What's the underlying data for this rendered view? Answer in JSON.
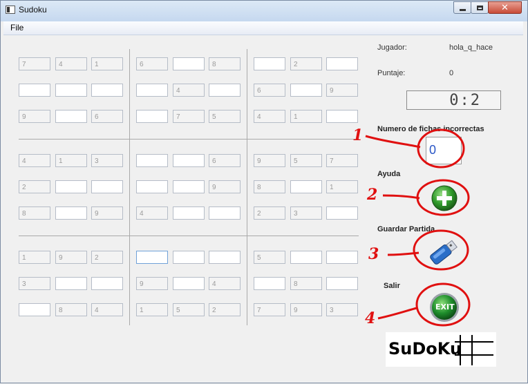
{
  "window": {
    "title": "Sudoku"
  },
  "menu": {
    "file": "File"
  },
  "grid_values": [
    [
      "7",
      "4",
      "1",
      "6",
      "",
      "8",
      "",
      "2",
      ""
    ],
    [
      "",
      "",
      "",
      "",
      "4",
      "",
      "6",
      "",
      "9"
    ],
    [
      "9",
      "",
      "6",
      "",
      "7",
      "5",
      "4",
      "1",
      ""
    ],
    [
      "4",
      "1",
      "3",
      "",
      "",
      "6",
      "9",
      "5",
      "7"
    ],
    [
      "2",
      "",
      "",
      "",
      "",
      "9",
      "8",
      "",
      "1"
    ],
    [
      "8",
      "",
      "9",
      "4",
      "",
      "",
      "2",
      "3",
      ""
    ],
    [
      "1",
      "9",
      "2",
      "",
      "",
      "",
      "5",
      "",
      ""
    ],
    [
      "3",
      "",
      "",
      "9",
      "",
      "4",
      "",
      "8",
      ""
    ],
    [
      "",
      "8",
      "4",
      "1",
      "5",
      "2",
      "7",
      "9",
      "3"
    ]
  ],
  "info": {
    "player_label": "Jugador:",
    "player_value": "hola_q_hace",
    "score_label": "Puntaje:",
    "score_value": "0",
    "timer": "0:2",
    "incorrect_label": "Numero de fichas incorrectas",
    "incorrect_value": "0",
    "help_label": "Ayuda",
    "save_label": "Guardar Partida",
    "exit_label": "Salir",
    "exit_icon_text": "EXIT"
  },
  "logo_text": "SuDoKu",
  "annotations": [
    "1",
    "2",
    "3",
    "4"
  ],
  "colors": {
    "annotation": "#e01010",
    "help_green": "#2f9a2a",
    "exit_green": "#1f8e2c",
    "save_blue": "#2a6ec8"
  }
}
